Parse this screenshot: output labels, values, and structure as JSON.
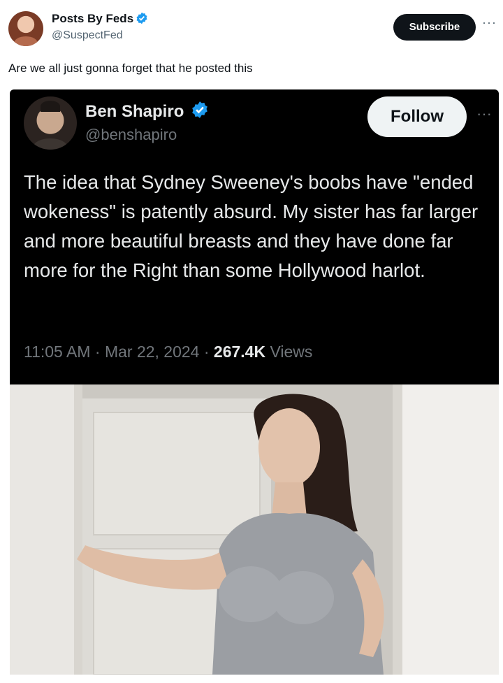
{
  "post": {
    "author_name": "Posts By Feds",
    "author_handle": "@SuspectFed",
    "subscribe_label": "Subscribe",
    "more_label": "···",
    "text": "Are we all just gonna forget that he posted this"
  },
  "embedded_tweet": {
    "author_name": "Ben Shapiro",
    "author_handle": "@benshapiro",
    "follow_label": "Follow",
    "more_label": "···",
    "body": "The idea that Sydney Sweeney's boobs have \"ended wokeness\" is patently absurd. My sister has far larger and more beautiful breasts and they have done far more for the Right than some Hollywood harlot.",
    "time": "11:05 AM",
    "separator_1": " · ",
    "date": "Mar 22, 2024",
    "separator_2": " · ",
    "views_count": "267.4K",
    "views_label": "Views"
  },
  "colors": {
    "verified": "#1d9bf0",
    "dark_background": "#000000",
    "dark_text": "#e7e9ea",
    "muted_text": "#71767b"
  },
  "icons": {
    "verified": "verified-badge-icon",
    "more": "more-dots-icon"
  }
}
